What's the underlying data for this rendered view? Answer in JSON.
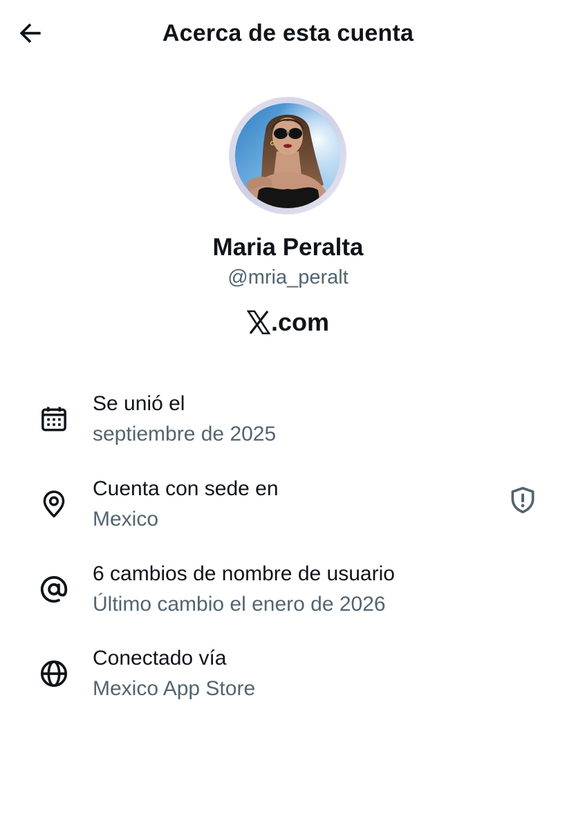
{
  "header": {
    "title": "Acerca de esta cuenta",
    "back_icon": "arrow-left-icon"
  },
  "profile": {
    "display_name": "Maria Peralta",
    "handle": "@mria_peralt",
    "domain_suffix": ".com",
    "brand_icon": "x-logo-icon"
  },
  "rows": [
    {
      "icon": "calendar-icon",
      "title": "Se unió el",
      "subtitle": "septiembre de 2025"
    },
    {
      "icon": "location-pin-icon",
      "title": "Cuenta con sede en",
      "subtitle": "Mexico",
      "trailing_icon": "shield-alert-icon"
    },
    {
      "icon": "at-sign-icon",
      "title": "6 cambios de nombre de usuario",
      "subtitle": "Último cambio el enero de 2026"
    },
    {
      "icon": "globe-icon",
      "title": "Conectado vía",
      "subtitle": "Mexico App Store"
    }
  ],
  "colors": {
    "text_primary": "#0f1419",
    "text_secondary": "#536471",
    "background": "#ffffff"
  }
}
